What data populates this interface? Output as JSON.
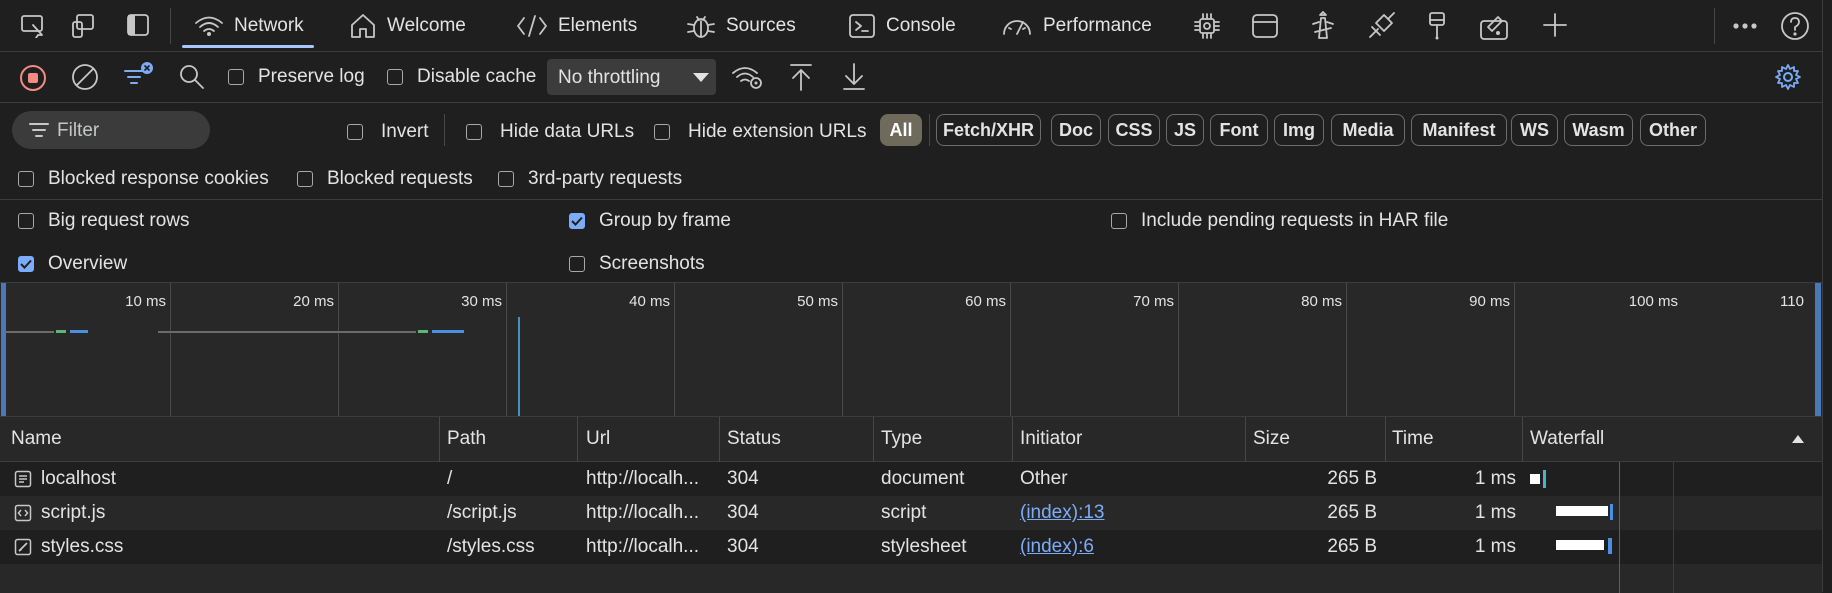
{
  "tabs": [
    {
      "label": "Network",
      "icon": "wifi-icon"
    },
    {
      "label": "Welcome",
      "icon": "home-icon"
    },
    {
      "label": "Elements",
      "icon": "code-brackets-icon"
    },
    {
      "label": "Sources",
      "icon": "bug-icon"
    },
    {
      "label": "Console",
      "icon": "terminal-icon"
    },
    {
      "label": "Performance",
      "icon": "gauge-icon"
    }
  ],
  "toolbar": {
    "preserve_log": "Preserve log",
    "disable_cache": "Disable cache",
    "throttling": "No throttling"
  },
  "filter": {
    "placeholder": "Filter",
    "invert": "Invert",
    "hide_data_urls": "Hide data URLs",
    "hide_extension_urls": "Hide extension URLs",
    "types": [
      "All",
      "Fetch/XHR",
      "Doc",
      "CSS",
      "JS",
      "Font",
      "Img",
      "Media",
      "Manifest",
      "WS",
      "Wasm",
      "Other"
    ],
    "blocked_cookies": "Blocked response cookies",
    "blocked_requests": "Blocked requests",
    "third_party": "3rd-party requests"
  },
  "settings": {
    "big_rows": "Big request rows",
    "group_by_frame": "Group by frame",
    "include_pending": "Include pending requests in HAR file",
    "overview": "Overview",
    "screenshots": "Screenshots",
    "checked": {
      "big_rows": false,
      "group_by_frame": true,
      "include_pending": false,
      "overview": true,
      "screenshots": false
    }
  },
  "overview": {
    "ticks": [
      "10 ms",
      "20 ms",
      "30 ms",
      "40 ms",
      "50 ms",
      "60 ms",
      "70 ms",
      "80 ms",
      "90 ms",
      "100 ms",
      "110"
    ]
  },
  "table": {
    "columns": [
      "Name",
      "Path",
      "Url",
      "Status",
      "Type",
      "Initiator",
      "Size",
      "Time",
      "Waterfall"
    ],
    "rows": [
      {
        "name": "localhost",
        "path": "/",
        "url": "http://localh...",
        "status": "304",
        "type": "document",
        "initiator": "Other",
        "size": "265 B",
        "time": "1 ms",
        "icon": "document-icon"
      },
      {
        "name": "script.js",
        "path": "/script.js",
        "url": "http://localh...",
        "status": "304",
        "type": "script",
        "initiator": "(index):13",
        "size": "265 B",
        "time": "1 ms",
        "icon": "script-icon"
      },
      {
        "name": "styles.css",
        "path": "/styles.css",
        "url": "http://localh...",
        "status": "304",
        "type": "stylesheet",
        "initiator": "(index):6",
        "size": "265 B",
        "time": "1 ms",
        "icon": "stylesheet-icon"
      }
    ]
  },
  "colors": {
    "accent": "#7cacf8",
    "record": "#f28b82",
    "bar_blue": "#4b8fe2",
    "bar_green": "#5bb974"
  }
}
